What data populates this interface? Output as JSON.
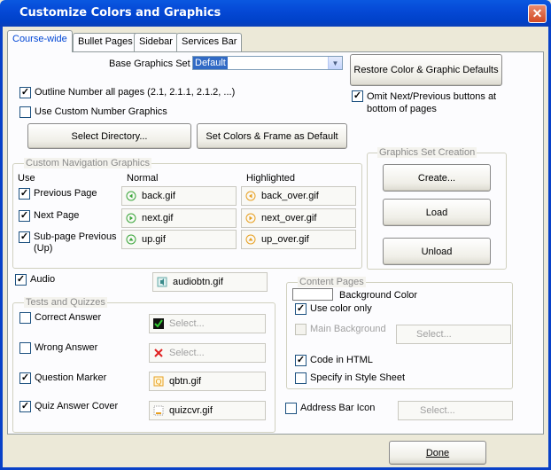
{
  "window": {
    "title": "Customize Colors and Graphics",
    "close_glyph": "✕"
  },
  "tabs": [
    "Course-wide",
    "Bullet Pages",
    "Sidebar",
    "Services Bar"
  ],
  "base_graphics": {
    "label": "Base Graphics Set",
    "value": "Default"
  },
  "buttons": {
    "restore": "Restore Color & Graphic Defaults",
    "select_directory": "Select Directory...",
    "set_colors": "Set Colors & Frame as Default",
    "create": "Create...",
    "load": "Load",
    "unload": "Unload",
    "done": "Done"
  },
  "options": {
    "outline_number": {
      "label": "Outline Number all pages (2.1, 2.1.1, 2.1.2, ...)",
      "checked": true
    },
    "custom_number": {
      "label": "Use Custom Number Graphics",
      "checked": false
    },
    "omit_next_prev": {
      "label": "Omit Next/Previous buttons at bottom of pages",
      "checked": true
    }
  },
  "nav_graphics": {
    "title": "Custom Navigation Graphics",
    "col_use": "Use",
    "col_normal": "Normal",
    "col_highlighted": "Highlighted",
    "rows": [
      {
        "label": "Previous Page",
        "checked": true,
        "normal": "back.gif",
        "highlighted": "back_over.gif",
        "icon": "left-arrow-icon"
      },
      {
        "label": "Next Page",
        "checked": true,
        "normal": "next.gif",
        "highlighted": "next_over.gif",
        "icon": "right-arrow-icon"
      },
      {
        "label": "Sub-page Previous (Up)",
        "checked": true,
        "normal": "up.gif",
        "highlighted": "up_over.gif",
        "icon": "up-arrow-icon"
      }
    ]
  },
  "graphics_set": {
    "title": "Graphics Set Creation"
  },
  "audio": {
    "label": "Audio",
    "checked": true,
    "file": "audiobtn.gif"
  },
  "tests": {
    "title": "Tests and Quizzes",
    "rows": [
      {
        "label": "Correct Answer",
        "checked": false,
        "file": "Select...",
        "icon": "checkmark-icon",
        "disabled": true
      },
      {
        "label": "Wrong Answer",
        "checked": false,
        "file": "Select...",
        "icon": "red-x-icon",
        "disabled": true
      },
      {
        "label": "Question Marker",
        "checked": true,
        "file": "qbtn.gif",
        "icon": "question-marker-icon",
        "disabled": false
      },
      {
        "label": "Quiz Answer Cover",
        "checked": true,
        "file": "quizcvr.gif",
        "icon": "answer-cover-icon",
        "disabled": false
      }
    ]
  },
  "content_pages": {
    "title": "Content Pages",
    "background_color_label": "Background Color",
    "background_color_value": "#ffffff",
    "use_color_only": {
      "label": "Use color only",
      "checked": true
    },
    "main_background": {
      "label": "Main Background",
      "checked": false,
      "disabled": true,
      "button": "Select..."
    },
    "code_in_html": {
      "label": "Code in HTML",
      "checked": true
    },
    "specify_style": {
      "label": "Specify in Style Sheet",
      "checked": false
    }
  },
  "address_bar": {
    "label": "Address Bar Icon",
    "checked": false,
    "button": "Select..."
  },
  "colors": {
    "title_bar": "#0054e3",
    "tab_active_text": "#0046d5",
    "dialog_bg": "#ece9d8",
    "selection": "#316ac5",
    "close_button": "#d34a24"
  }
}
